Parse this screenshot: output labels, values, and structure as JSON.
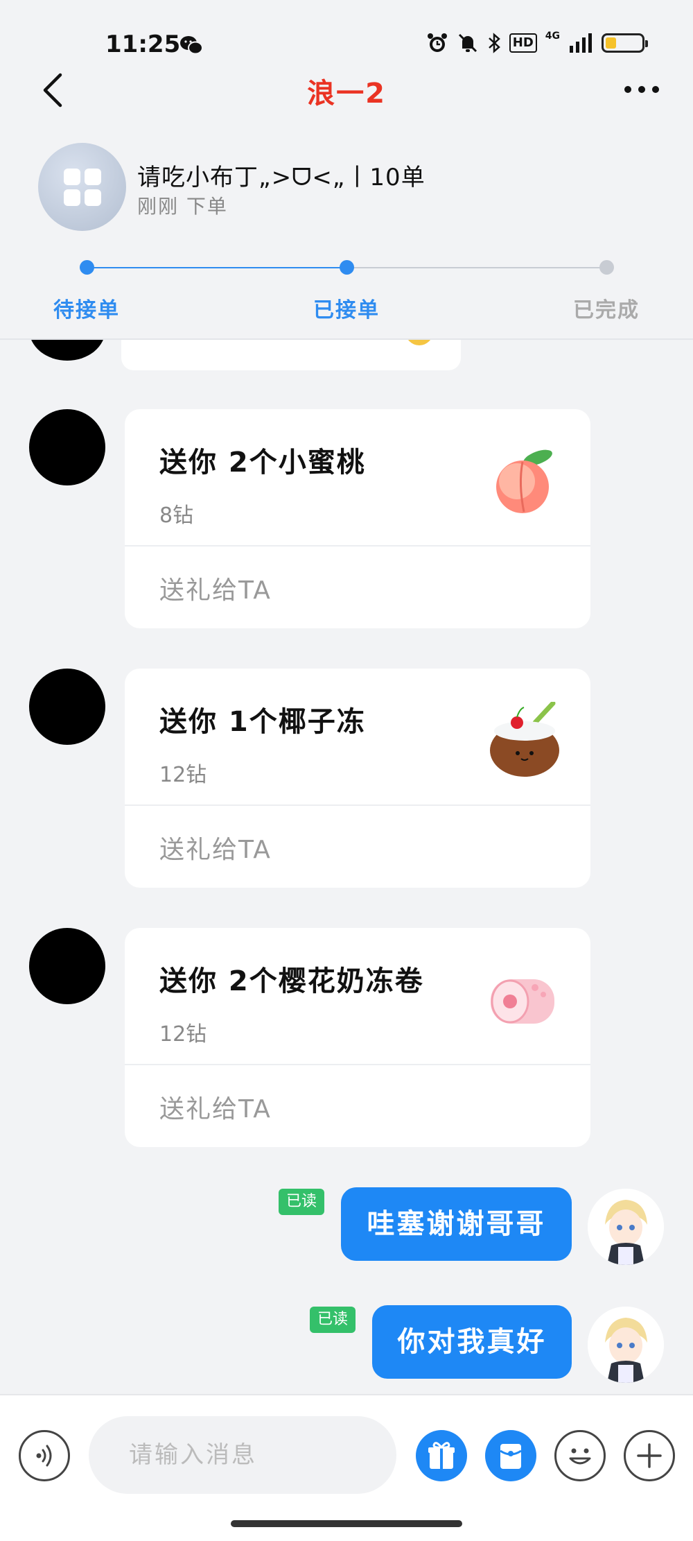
{
  "status_bar": {
    "time": "11:25",
    "network_label": "4G",
    "hd_label": "HD",
    "battery_level": 0.3
  },
  "nav": {
    "title": "浪一2"
  },
  "order": {
    "title": "请吃小布丁„>ᗜ<„丨10单",
    "subtitle": "刚刚 下单"
  },
  "steps": [
    {
      "label": "待接单",
      "state": "done",
      "color": "#2f8cf0"
    },
    {
      "label": "已接单",
      "state": "current",
      "color": "#2f8cf0"
    },
    {
      "label": "已完成",
      "state": "todo",
      "color": "#aaaaaa"
    }
  ],
  "gifts": [
    {
      "title": "送你 2个小蜜桃",
      "price": "8钻",
      "action": "送礼给TA",
      "icon": "peach-icon"
    },
    {
      "title": "送你 1个椰子冻",
      "price": "12钻",
      "action": "送礼给TA",
      "icon": "coconut-icon"
    },
    {
      "title": "送你 2个樱花奶冻卷",
      "price": "12钻",
      "action": "送礼给TA",
      "icon": "sakura-roll-icon"
    }
  ],
  "my_messages": [
    {
      "text": "哇塞谢谢哥哥",
      "badge": "已读"
    },
    {
      "text": "你对我真好",
      "badge": "已读"
    }
  ],
  "input": {
    "placeholder": "请输入消息"
  },
  "colors": {
    "accent": "#1e88f5",
    "title_red": "#ea3323",
    "read_green": "#34c06a"
  }
}
